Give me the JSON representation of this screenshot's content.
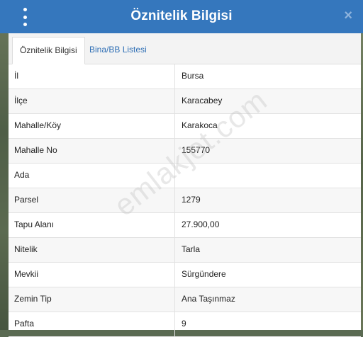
{
  "dialog": {
    "title": "Öznitelik Bilgisi",
    "close_glyph": "×",
    "accent_color": "#3577bd"
  },
  "tabs": [
    {
      "label": "Öznitelik Bilgisi",
      "active": true
    },
    {
      "label": "Bina/BB Listesi",
      "active": false
    }
  ],
  "rows": [
    {
      "label": "İl",
      "value": "Bursa"
    },
    {
      "label": "İlçe",
      "value": "Karacabey"
    },
    {
      "label": "Mahalle/Köy",
      "value": "Karakoca"
    },
    {
      "label": "Mahalle No",
      "value": "155770"
    },
    {
      "label": "Ada",
      "value": ""
    },
    {
      "label": "Parsel",
      "value": "1279"
    },
    {
      "label": "Tapu Alanı",
      "value": "27.900,00"
    },
    {
      "label": "Nitelik",
      "value": "Tarla"
    },
    {
      "label": "Mevkii",
      "value": "Sürgündere"
    },
    {
      "label": "Zemin Tip",
      "value": "Ana Taşınmaz"
    },
    {
      "label": "Pafta",
      "value": "9"
    }
  ],
  "watermark": "emlakjet.com"
}
